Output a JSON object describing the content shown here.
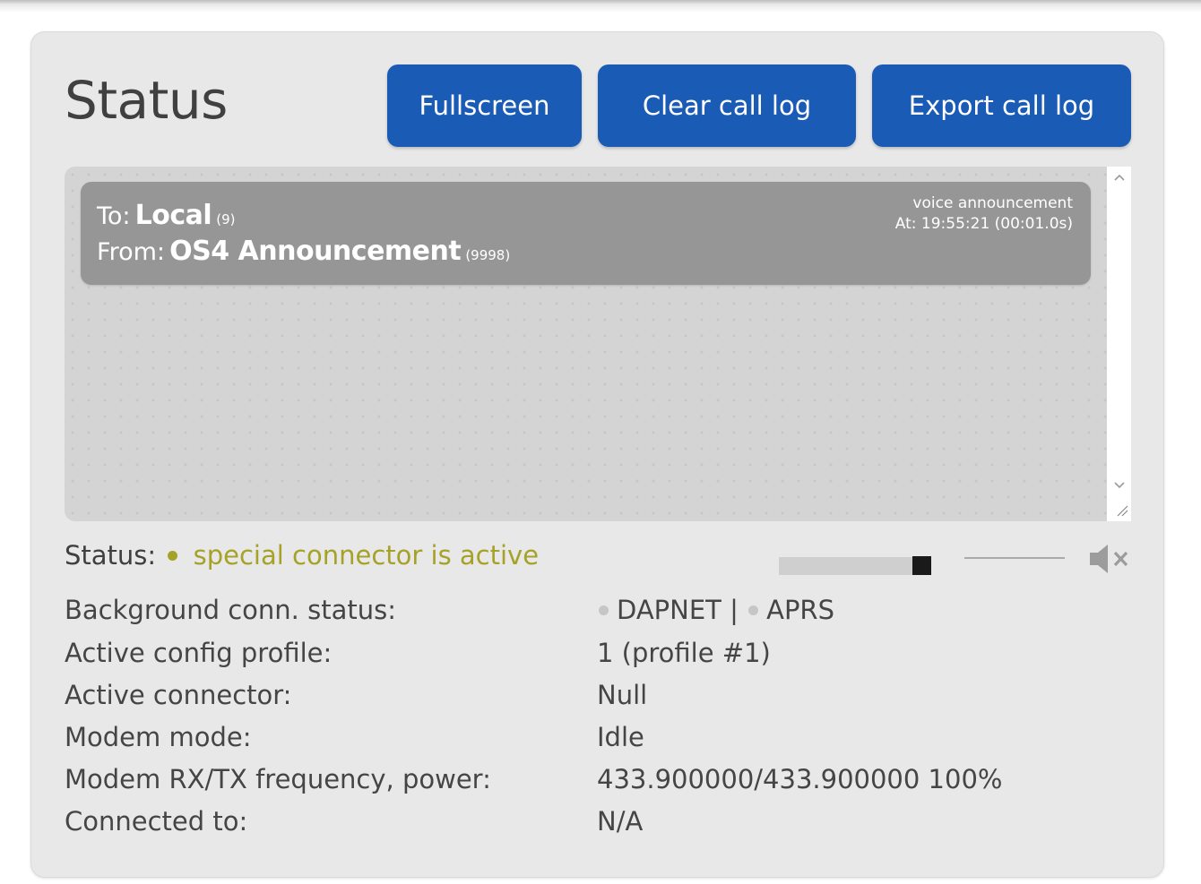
{
  "header": {
    "title": "Status",
    "buttons": {
      "fullscreen": "Fullscreen",
      "clear_log": "Clear call log",
      "export_log": "Export call log"
    }
  },
  "call_log": {
    "entries": [
      {
        "to_label": "To:",
        "to_name": "Local",
        "to_id": "(9)",
        "from_label": "From:",
        "from_name": "OS4 Announcement",
        "from_id": "(9998)",
        "type": "voice announcement",
        "time": "At: 19:55:21 (00:01.0s)"
      }
    ]
  },
  "status": {
    "label": "Status:",
    "value": "special connector is active",
    "indicator_color": "#a6a227"
  },
  "volume": {
    "level": 0.94,
    "muted": true,
    "icon": "speaker-muted-icon"
  },
  "info": {
    "background_conn": {
      "label": "Background conn. status:",
      "dapnet": "DAPNET",
      "separator": "|",
      "aprs": "APRS"
    },
    "profile": {
      "label": "Active config profile:",
      "value": "1 (profile #1)"
    },
    "connector": {
      "label": "Active connector:",
      "value": "Null"
    },
    "modem_mode": {
      "label": "Modem mode:",
      "value": "Idle"
    },
    "modem_freq": {
      "label": "Modem RX/TX frequency, power:",
      "value": "433.900000/433.900000 100%"
    },
    "connected_to": {
      "label": "Connected to:",
      "value": "N/A"
    }
  },
  "colors": {
    "button": "#1a5bb5",
    "card": "#969696",
    "status_active": "#a6a227"
  }
}
